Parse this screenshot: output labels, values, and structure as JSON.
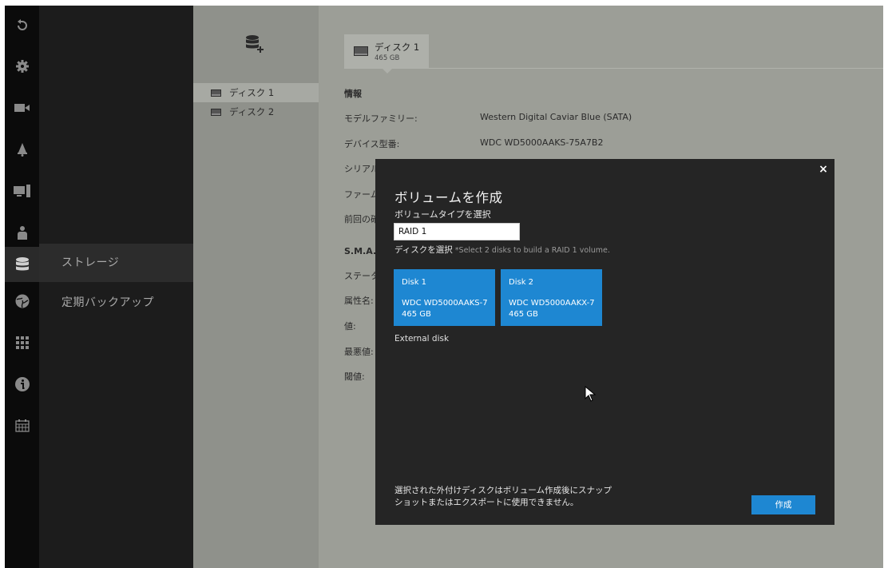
{
  "sidebar": {
    "icons": [
      "undo-icon",
      "gear-icon",
      "camera-icon",
      "bell-icon",
      "monitor-icon",
      "user-icon",
      "storage-icon",
      "network-icon",
      "apps-icon",
      "info-icon",
      "calendar-icon"
    ],
    "menu_items": [
      {
        "label": "ストレージ",
        "active": true
      },
      {
        "label": "定期バックアップ",
        "active": false
      }
    ]
  },
  "disk_list": {
    "add_icon": "add-volume-icon",
    "disks": [
      {
        "label": "ディスク 1",
        "active": true
      },
      {
        "label": "ディスク 2",
        "active": false
      }
    ]
  },
  "detail": {
    "tab": {
      "name": "ディスク 1",
      "size": "465 GB"
    },
    "info_heading": "情報",
    "rows": [
      {
        "label": "モデルファミリー:",
        "value": "Western Digital Caviar Blue (SATA)"
      },
      {
        "label": "デバイス型番:",
        "value": "WDC WD5000AAKS-75A7B2"
      },
      {
        "label": "シリアル",
        "value": ""
      },
      {
        "label": "ファーム",
        "value": ""
      },
      {
        "label": "前回の確",
        "value": ""
      }
    ],
    "smart_heading": "S.M.A.R.",
    "smart_rows": [
      "ステータ",
      "属性名:",
      "値:",
      "最悪値:",
      "閾値:"
    ]
  },
  "modal": {
    "title": "ボリュームを作成",
    "type_label": "ボリュームタイプを選択",
    "type_value": "RAID 1",
    "disk_label": "ディスクを選択",
    "disk_hint": " *Select 2 disks to build a RAID 1 volume.",
    "disks": [
      {
        "name": "Disk 1",
        "model": "WDC WD5000AAKS-7",
        "size": "465 GB"
      },
      {
        "name": "Disk 2",
        "model": "WDC WD5000AAKX-7",
        "size": "465 GB"
      }
    ],
    "external_label": "External disk",
    "note_line1": "選択された外付けディスクはボリューム作成後にスナップ",
    "note_line2": "ショットまたはエクスポートに使用できません。",
    "create_label": "作成",
    "close_label": "×"
  },
  "colors": {
    "accent": "#1e87d2",
    "rail": "#0b0b0b",
    "menu": "#1c1c1c",
    "modal": "#252525"
  }
}
